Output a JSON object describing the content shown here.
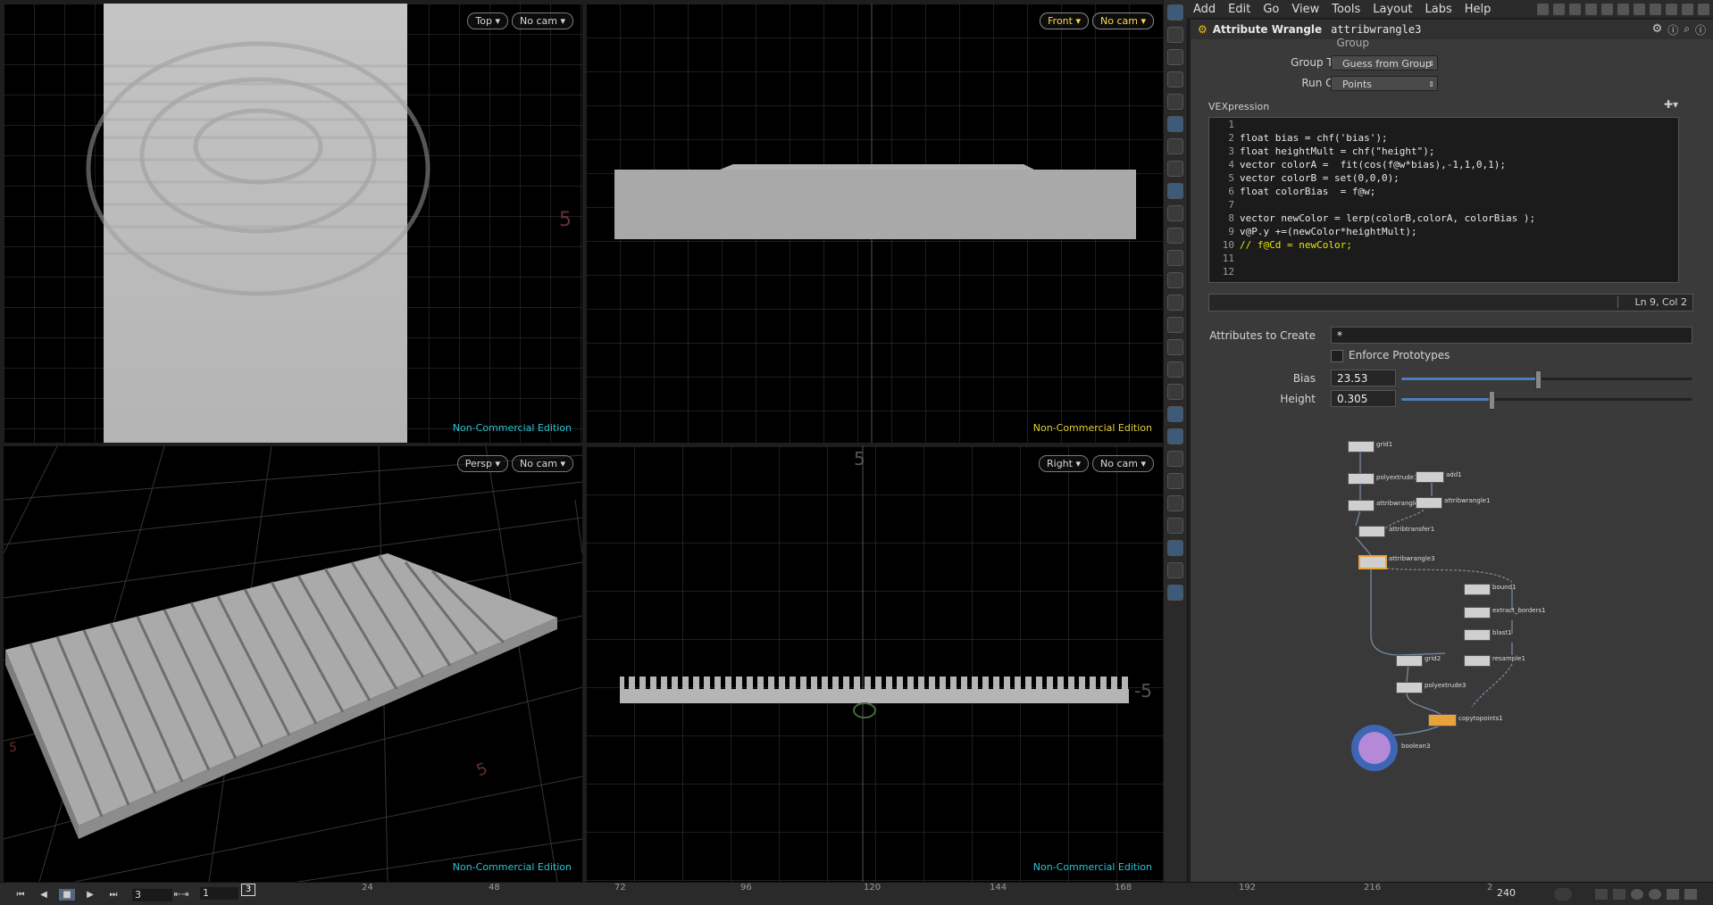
{
  "viewports": [
    {
      "name": "top",
      "view_label": "Top",
      "cam_label": "No cam",
      "watermark": "Non-Commercial Edition",
      "axis_label": "5"
    },
    {
      "name": "front",
      "view_label": "Front",
      "cam_label": "No cam",
      "watermark": "Non-Commercial Edition"
    },
    {
      "name": "persp",
      "view_label": "Persp",
      "cam_label": "No cam",
      "watermark": "Non-Commercial Edition",
      "axis_labels": [
        "5",
        "5"
      ]
    },
    {
      "name": "right",
      "view_label": "Right",
      "cam_label": "No cam",
      "watermark": "Non-Commercial Edition",
      "axis_labels": [
        "5",
        "-5"
      ]
    }
  ],
  "menubar": {
    "items": [
      "Add",
      "Edit",
      "Go",
      "View",
      "Tools",
      "Layout",
      "Labs",
      "Help"
    ]
  },
  "param": {
    "node_type": "Attribute Wrangle",
    "node_name": "attribwrangle3",
    "group_label": "Group",
    "group_type_label": "Group Type",
    "group_type_value": "Guess from Group",
    "run_over_label": "Run Over",
    "run_over_value": "Points",
    "vex_label": "VEXpression",
    "code_lines": [
      {
        "n": "1",
        "t": ""
      },
      {
        "n": "2",
        "t": "float bias = chf('bias');"
      },
      {
        "n": "3",
        "t": "float heightMult = chf(\"height\");"
      },
      {
        "n": "4",
        "t": "vector colorA =  fit(cos(f@w*bias),-1,1,0,1);"
      },
      {
        "n": "5",
        "t": "vector colorB = set(0,0,0);"
      },
      {
        "n": "6",
        "t": "float colorBias  = f@w;"
      },
      {
        "n": "7",
        "t": ""
      },
      {
        "n": "8",
        "t": "vector newColor = lerp(colorB,colorA, colorBias );"
      },
      {
        "n": "9",
        "t": "v@P.y +=(newColor*heightMult);"
      },
      {
        "n": "10",
        "t": "// f@Cd = newColor;"
      },
      {
        "n": "11",
        "t": ""
      },
      {
        "n": "12",
        "t": ""
      }
    ],
    "cursor_pos": "Ln 9, Col 2",
    "attrs_label": "Attributes to Create",
    "attrs_value": "*",
    "enforce_label": "Enforce Prototypes",
    "bias_label": "Bias",
    "bias_value": "23.53",
    "bias_fraction": 0.47,
    "height_label": "Height",
    "height_value": "0.305",
    "height_fraction": 0.31
  },
  "network": {
    "nodes": [
      "grid1",
      "polyextrude1",
      "add1",
      "attribwrangle2",
      "attribwrangle1",
      "attribtransfer1",
      "attribwrangle3",
      "bound1",
      "extract_borders1",
      "blast1",
      "resample1",
      "grid2",
      "polyextrude3",
      "copytopoints1",
      "boolean3"
    ]
  },
  "timeline": {
    "frame_field": "3",
    "start_field": "1",
    "current_frame": "3",
    "end_frame": "240",
    "ticks": [
      "24",
      "48",
      "72",
      "96",
      "120",
      "144",
      "168",
      "192",
      "216",
      "2"
    ]
  },
  "colors": {
    "watermark": "#2ec4d4",
    "accent_yellow": "#e3d33a",
    "node_orange": "#e8a23a",
    "selection_blue": "#4a7fbf"
  }
}
